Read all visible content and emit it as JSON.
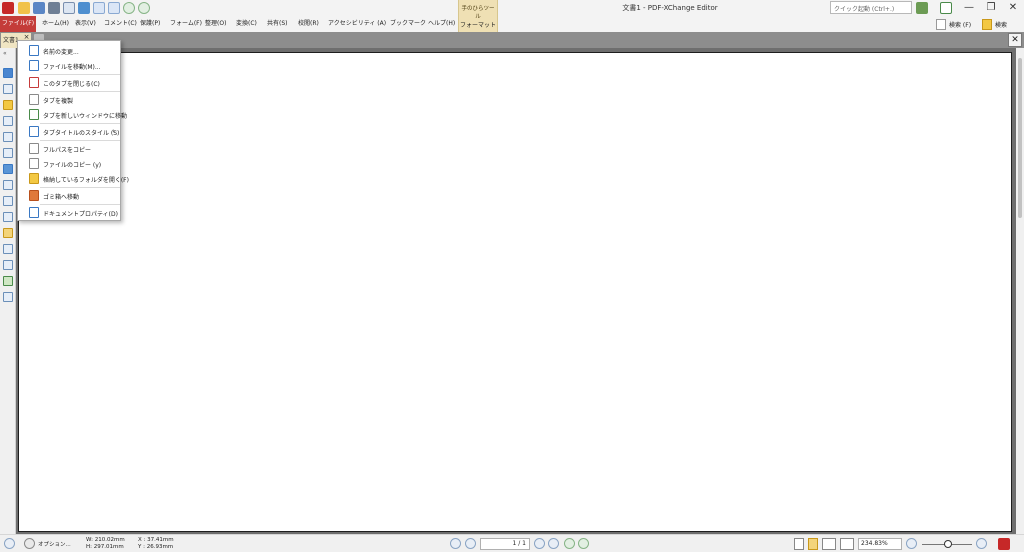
{
  "window": {
    "title": "文書1 - PDF-XChange Editor",
    "quick_launch_placeholder": "クイック起動 (Ctrl+.)",
    "controls": {
      "minimize": "—",
      "restore": "❐",
      "close": "✕"
    }
  },
  "menubar": {
    "file": "ファイル(F)",
    "items": [
      "ホーム(H)",
      "表示(V)",
      "コメント(C)",
      "保護(P)",
      "フォーム(F)",
      "整理(O)",
      "変換(C)",
      "共有(S)",
      "校閲(R)",
      "アクセシビリティ (A)",
      "ブックマーク",
      "ヘルプ(H)"
    ],
    "context_group": "手のひらツール",
    "context_tab": "フォーマット",
    "search_label": "検索 (F)",
    "search2_label": "検索"
  },
  "tabs": {
    "doc_tab_label": "文書1",
    "close_glyph": "×"
  },
  "file_menu": {
    "items": [
      {
        "label": "名前の変更..."
      },
      {
        "label": "ファイルを移動(M)..."
      },
      {
        "label": "このタブを閉じる(C)"
      },
      {
        "label": "タブを複製"
      },
      {
        "label": "タブを新しいウィンドウに移動"
      },
      {
        "label": "タブタイトルのスタイル (S)"
      },
      {
        "label": "フルパスをコピー"
      },
      {
        "label": "ファイルのコピー (y)"
      },
      {
        "label": "格納しているフォルダを開く(F)"
      },
      {
        "label": "ゴミ箱へ移動"
      },
      {
        "label": "ドキュメントプロパティ(D)"
      }
    ],
    "submenu_arrow": "›"
  },
  "statusbar": {
    "options": "オプション...",
    "width": "W: 210.02mm",
    "height": "H: 297.01mm",
    "x": "X : 37.41mm",
    "y": "Y : 26.93mm",
    "page": "1 / 1",
    "zoom": "234.83%"
  },
  "colors": {
    "file_menu_red": "#c43c39",
    "context_tab_tan": "#efe0b4",
    "tab_strip_gray": "#8d8d8d"
  }
}
